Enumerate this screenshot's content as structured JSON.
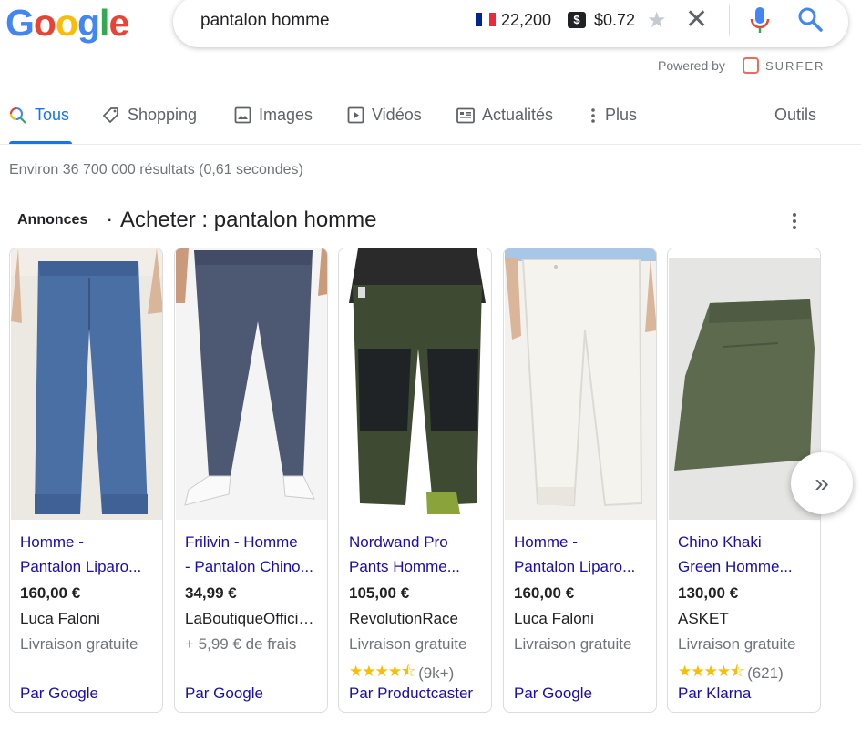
{
  "logo": {
    "letters": [
      "G",
      "o",
      "o",
      "g",
      "l",
      "e"
    ],
    "colors": [
      "#4285f4",
      "#ea4335",
      "#fbbc05",
      "#4285f4",
      "#34a853",
      "#ea4335"
    ]
  },
  "search": {
    "query": "pantalon homme",
    "volume": "22,200",
    "cpc_symbol": "$",
    "cpc": "$0.72"
  },
  "surfer": {
    "powered_by": "Powered by",
    "brand": "SURFER"
  },
  "tabs": [
    {
      "label": "Tous",
      "icon": "search-icon",
      "active": true
    },
    {
      "label": "Shopping",
      "icon": "tag-icon"
    },
    {
      "label": "Images",
      "icon": "image-icon"
    },
    {
      "label": "Vidéos",
      "icon": "play-icon"
    },
    {
      "label": "Actualités",
      "icon": "news-icon"
    },
    {
      "label": "Plus",
      "icon": "more-vert-icon"
    },
    {
      "label": "Outils"
    }
  ],
  "results_stats": "Environ 36 700 000 résultats (0,61 secondes)",
  "ads": {
    "label": "Annonces",
    "separator": "·",
    "title": "Acheter : pantalon homme",
    "products": [
      {
        "title1": "Homme -",
        "title2": "Pantalon Liparo...",
        "price": "160,00 €",
        "seller": "Luca Faloni",
        "shipping": "Livraison gratuite",
        "rating": null,
        "by": "Par Google",
        "color": "#4a6fa5",
        "bg": "#ece8e2"
      },
      {
        "title1": "Frilivin - Homme",
        "title2": "- Pantalon Chino...",
        "price": "34,99 €",
        "seller": "LaBoutiqueOfficielle",
        "shipping": "+ 5,99 € de frais",
        "rating": null,
        "by": "Par Google",
        "color": "#4d5873",
        "bg": "#f4f4f4"
      },
      {
        "title1": "Nordwand Pro",
        "title2": "Pants Homme...",
        "price": "105,00 €",
        "seller": "RevolutionRace",
        "shipping": "Livraison gratuite",
        "rating": {
          "stars": "★★★★⯪",
          "count": "(9k+)"
        },
        "by": "Par Productcaster",
        "color": "#3e4a32",
        "bg": "#ffffff"
      },
      {
        "title1": "Homme -",
        "title2": "Pantalon Liparo...",
        "price": "160,00 €",
        "seller": "Luca Faloni",
        "shipping": "Livraison gratuite",
        "rating": null,
        "by": "Par Google",
        "color": "#ecebe6",
        "bg": "#f3f1ed"
      },
      {
        "title1": "Chino Khaki",
        "title2": "Green Homme...",
        "price": "130,00 €",
        "seller": "ASKET",
        "shipping": "Livraison gratuite",
        "rating": {
          "stars": "★★★★⯪",
          "count": "(621)"
        },
        "by": "Par Klarna",
        "color": "#5d6a4e",
        "bg": "#e5e5e4"
      }
    ]
  },
  "next_label": "»"
}
